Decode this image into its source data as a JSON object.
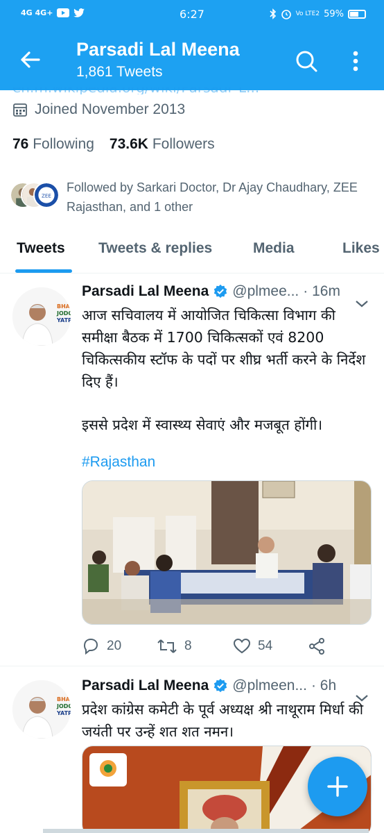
{
  "status_bar": {
    "left_icons": "4G 4G+",
    "time": "6:27",
    "right_icons": "Vo LTE2",
    "battery": "59%"
  },
  "header": {
    "title": "Parsadi Lal Meena",
    "subtitle": "1,861 Tweets"
  },
  "profile": {
    "faded_link": "en.m.wikipedia.org/wiki/Parsadi_L...",
    "joined": "Joined November 2013",
    "following_count": "76",
    "following_label": "Following",
    "followers_count": "73.6K",
    "followers_label": "Followers",
    "followed_by": "Followed by Sarkari Doctor, Dr Ajay Chaudhary, ZEE Rajasthan, and 1 other"
  },
  "tabs": [
    "Tweets",
    "Tweets & replies",
    "Media",
    "Likes"
  ],
  "tweets": [
    {
      "name": "Parsadi Lal Meena",
      "handle": "@plmee...",
      "time": "· 16m",
      "text_line1": "आज सचिवालय में आयोजित चिकित्सा विभाग की समीक्षा बैठक में 1700 चिकित्सकों एवं 8200 चिकित्सकीय स्टॉफ के पदों पर शीघ्र भर्ती करने के निर्देश दिए हैं।",
      "text_line2": "इससे प्रदेश में स्वास्थ्य सेवाएं और मजबूत होंगी।",
      "hashtag": "#Rajasthan",
      "replies": "20",
      "retweets": "8",
      "likes": "54"
    },
    {
      "name": "Parsadi Lal Meena",
      "handle": "@plmeen...",
      "time": "· 6h",
      "text_line1": "प्रदेश कांग्रेस कमेटी के पूर्व अध्यक्ष श्री नाथूराम मिर्धा की जयंती पर उन्हें शत शत नमन।"
    }
  ],
  "colors": {
    "accent": "#1d9bf0",
    "header_bg": "#1da1f2",
    "secondary_text": "#536471"
  }
}
